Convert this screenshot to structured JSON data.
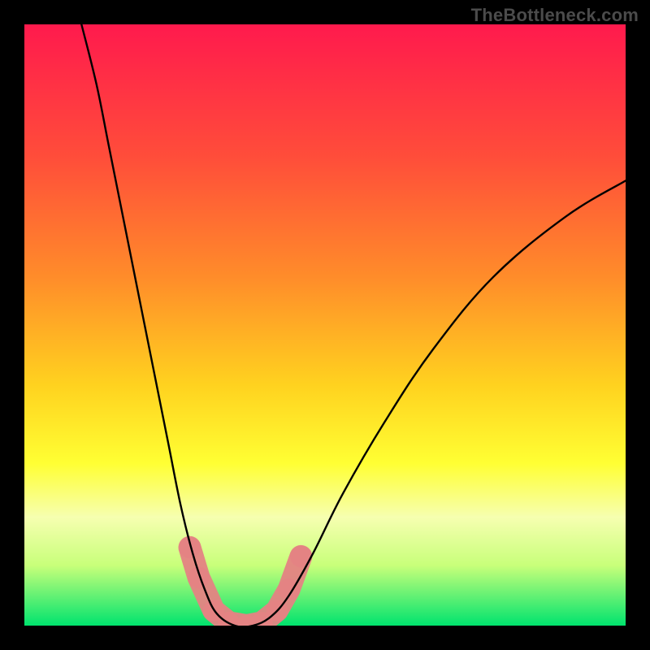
{
  "watermark": "TheBottleneck.com",
  "chart_data": {
    "type": "line",
    "title": "",
    "xlabel": "",
    "ylabel": "",
    "xlim": [
      0,
      100
    ],
    "ylim": [
      0,
      100
    ],
    "grid": false,
    "legend": false,
    "background_gradient": {
      "stops": [
        {
          "pct": 0,
          "color": "#ff1a4d"
        },
        {
          "pct": 22,
          "color": "#ff4d3a"
        },
        {
          "pct": 42,
          "color": "#ff8c2a"
        },
        {
          "pct": 60,
          "color": "#ffd21f"
        },
        {
          "pct": 73,
          "color": "#ffff33"
        },
        {
          "pct": 82,
          "color": "#f6ffb0"
        },
        {
          "pct": 90,
          "color": "#c8ff7a"
        },
        {
          "pct": 100,
          "color": "#00e36e"
        }
      ]
    },
    "series": [
      {
        "name": "curve",
        "color": "#000000",
        "stroke_width": 2.4,
        "points": [
          {
            "x": 9.5,
            "y": 100.0
          },
          {
            "x": 12.0,
            "y": 90.0
          },
          {
            "x": 14.0,
            "y": 80.0
          },
          {
            "x": 16.0,
            "y": 70.0
          },
          {
            "x": 18.0,
            "y": 60.0
          },
          {
            "x": 20.0,
            "y": 50.0
          },
          {
            "x": 22.0,
            "y": 40.0
          },
          {
            "x": 24.0,
            "y": 30.0
          },
          {
            "x": 26.0,
            "y": 20.0
          },
          {
            "x": 28.0,
            "y": 12.0
          },
          {
            "x": 30.0,
            "y": 6.0
          },
          {
            "x": 32.0,
            "y": 2.0
          },
          {
            "x": 35.0,
            "y": 0.0
          },
          {
            "x": 38.0,
            "y": 0.0
          },
          {
            "x": 41.0,
            "y": 1.5
          },
          {
            "x": 44.0,
            "y": 5.0
          },
          {
            "x": 48.0,
            "y": 12.0
          },
          {
            "x": 53.0,
            "y": 22.0
          },
          {
            "x": 60.0,
            "y": 34.0
          },
          {
            "x": 68.0,
            "y": 46.0
          },
          {
            "x": 78.0,
            "y": 58.0
          },
          {
            "x": 90.0,
            "y": 68.0
          },
          {
            "x": 100.0,
            "y": 74.0
          }
        ]
      },
      {
        "name": "markers",
        "type": "scatter",
        "color": "#e48383",
        "marker_radius": 14,
        "points": [
          {
            "x": 27.5,
            "y": 13.0
          },
          {
            "x": 29.0,
            "y": 8.0
          },
          {
            "x": 31.5,
            "y": 2.5
          },
          {
            "x": 34.0,
            "y": 0.5
          },
          {
            "x": 37.0,
            "y": 0.0
          },
          {
            "x": 39.5,
            "y": 0.5
          },
          {
            "x": 42.0,
            "y": 2.5
          },
          {
            "x": 44.0,
            "y": 6.0
          },
          {
            "x": 46.0,
            "y": 11.5
          }
        ]
      }
    ]
  }
}
